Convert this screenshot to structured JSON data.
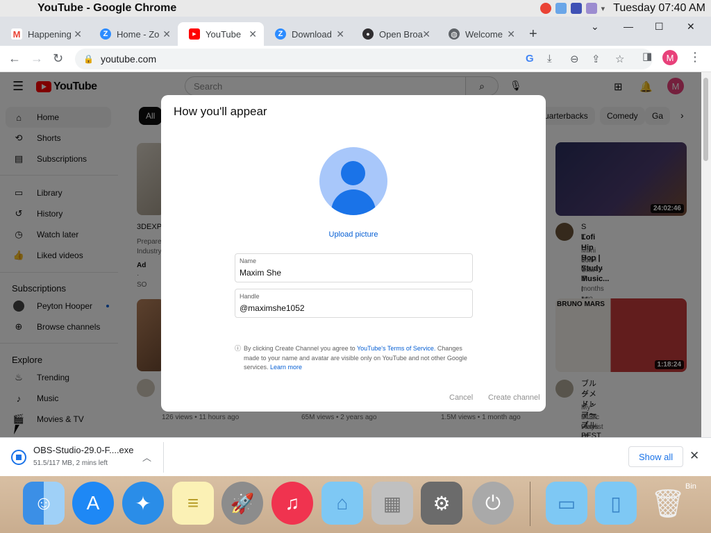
{
  "menubar": {
    "app_name": "YouTube - Google Chrome",
    "clock": "Tuesday 07:40 AM"
  },
  "tabs": [
    {
      "label": "Happening",
      "favicon": "gmail-icon",
      "color": "#ea4335",
      "glyph": "M"
    },
    {
      "label": "Home - Zo",
      "favicon": "zoom-icon",
      "color": "#2d8cff",
      "glyph": "Z"
    },
    {
      "label": "YouTube",
      "favicon": "youtube-icon",
      "color": "#ff0000",
      "glyph": "▶"
    },
    {
      "label": "Download",
      "favicon": "zoom-icon",
      "color": "#2d8cff",
      "glyph": "Z"
    },
    {
      "label": "Open Broa",
      "favicon": "obs-icon",
      "color": "#302e31",
      "glyph": "●"
    },
    {
      "label": "Welcome",
      "favicon": "globe-icon",
      "color": "#5f6368",
      "glyph": "◍"
    }
  ],
  "address_bar": {
    "url": "youtube.com"
  },
  "profile_initial": "M",
  "youtube": {
    "logo_text": "YouTube",
    "search_placeholder": "Search",
    "avatar_initial": "M",
    "sidebar": {
      "main": [
        {
          "label": "Home",
          "icon": "home-icon",
          "glyph": "⌂"
        },
        {
          "label": "Shorts",
          "icon": "shorts-icon",
          "glyph": "⟲"
        },
        {
          "label": "Subscriptions",
          "icon": "subscriptions-icon",
          "glyph": "▤"
        }
      ],
      "library": [
        {
          "label": "Library",
          "icon": "library-icon",
          "glyph": "▭"
        },
        {
          "label": "History",
          "icon": "history-icon",
          "glyph": "↺"
        },
        {
          "label": "Watch later",
          "icon": "clock-icon",
          "glyph": "◷"
        },
        {
          "label": "Liked videos",
          "icon": "thumbs-up-icon",
          "glyph": "👍"
        }
      ],
      "subscriptions_heading": "Subscriptions",
      "subscriptions": [
        {
          "label": "Peyton Hooper"
        },
        {
          "label": "Browse channels",
          "icon": "plus-circle-icon",
          "glyph": "⊕"
        }
      ],
      "explore_heading": "Explore",
      "explore": [
        {
          "label": "Trending",
          "icon": "fire-icon",
          "glyph": "♨"
        },
        {
          "label": "Music",
          "icon": "music-icon",
          "glyph": "♪"
        },
        {
          "label": "Movies & TV",
          "icon": "film-icon",
          "glyph": "🎬"
        }
      ]
    },
    "chips": [
      "All",
      "uarterbacks",
      "Comedy",
      "Ga"
    ],
    "videos": [
      {
        "partial_title": "3DEXPE",
        "desc_line1": "Prepare",
        "desc_line2": "Industry",
        "ad_label": "Ad",
        "ad_source": "· SO"
      },
      {
        "title_line1": "S T U D Y   T I M E ✍",
        "title_line2": "Lofi Hip Hop | Study Music...",
        "channel": "Mimi Lofi Chill",
        "stats": "3.8M views • 9 months ago",
        "duration": "24:02:46"
      },
      {
        "title_line1": "ブルーノ・マーズ BESTソン",
        "title_line2": "グメドレー～ブルーノ・マ...",
        "channel": "My Music Playlist",
        "stats": "943K views • 2 years ago",
        "duration": "1:18:24",
        "thumb_text": "BRUNO MARS"
      }
    ],
    "row_stats": [
      "126 views • 11 hours ago",
      "65M views • 2 years ago",
      "1.5M views • 1 month ago"
    ]
  },
  "dialog": {
    "title": "How you'll appear",
    "upload_label": "Upload picture",
    "name_label": "Name",
    "name_value": "Maxim She",
    "handle_label": "Handle",
    "handle_value": "@maximshe1052",
    "terms_prefix": "By clicking Create Channel you agree to ",
    "terms_link": "YouTube's Terms of Service.",
    "terms_mid": " Changes made to your name and avatar are visible only on YouTube and not other Google services. ",
    "learn_more": "Learn more",
    "cancel_label": "Cancel",
    "create_label": "Create channel"
  },
  "download": {
    "file_name": "OBS-Studio-29.0-F....exe",
    "progress": "51.5/117 MB, 2 mins left",
    "show_all": "Show all"
  },
  "dock": {
    "items": [
      {
        "name": "finder-icon",
        "color": "#3b8fe6",
        "glyph": "☺"
      },
      {
        "name": "app-store-icon",
        "color": "#1e88f5",
        "glyph": "A"
      },
      {
        "name": "safari-icon",
        "color": "#2a8de8",
        "glyph": "✦"
      },
      {
        "name": "notes-icon",
        "color": "#f7e27a",
        "glyph": "≡"
      },
      {
        "name": "launchpad-icon",
        "color": "#8c8c8c",
        "glyph": "🚀"
      },
      {
        "name": "music-app-icon",
        "color": "#f0334f",
        "glyph": "♫"
      },
      {
        "name": "applications-folder-icon",
        "color": "#7ec8f4",
        "glyph": "⌂"
      },
      {
        "name": "mac-pro-icon",
        "color": "#b8b8b8",
        "glyph": "▦"
      },
      {
        "name": "system-preferences-icon",
        "color": "#6b6b6b",
        "glyph": "⚙"
      },
      {
        "name": "shutdown-icon",
        "color": "#9c9c9c",
        "glyph": "⏻"
      },
      {
        "name": "downloads-folder-icon",
        "color": "#7ec8f4",
        "glyph": "▭"
      },
      {
        "name": "documents-folder-icon",
        "color": "#7ec8f4",
        "glyph": "▯"
      },
      {
        "name": "trash-icon",
        "color": "#e8e8e8",
        "glyph": "🗑"
      }
    ],
    "trash_label": "Bin"
  }
}
